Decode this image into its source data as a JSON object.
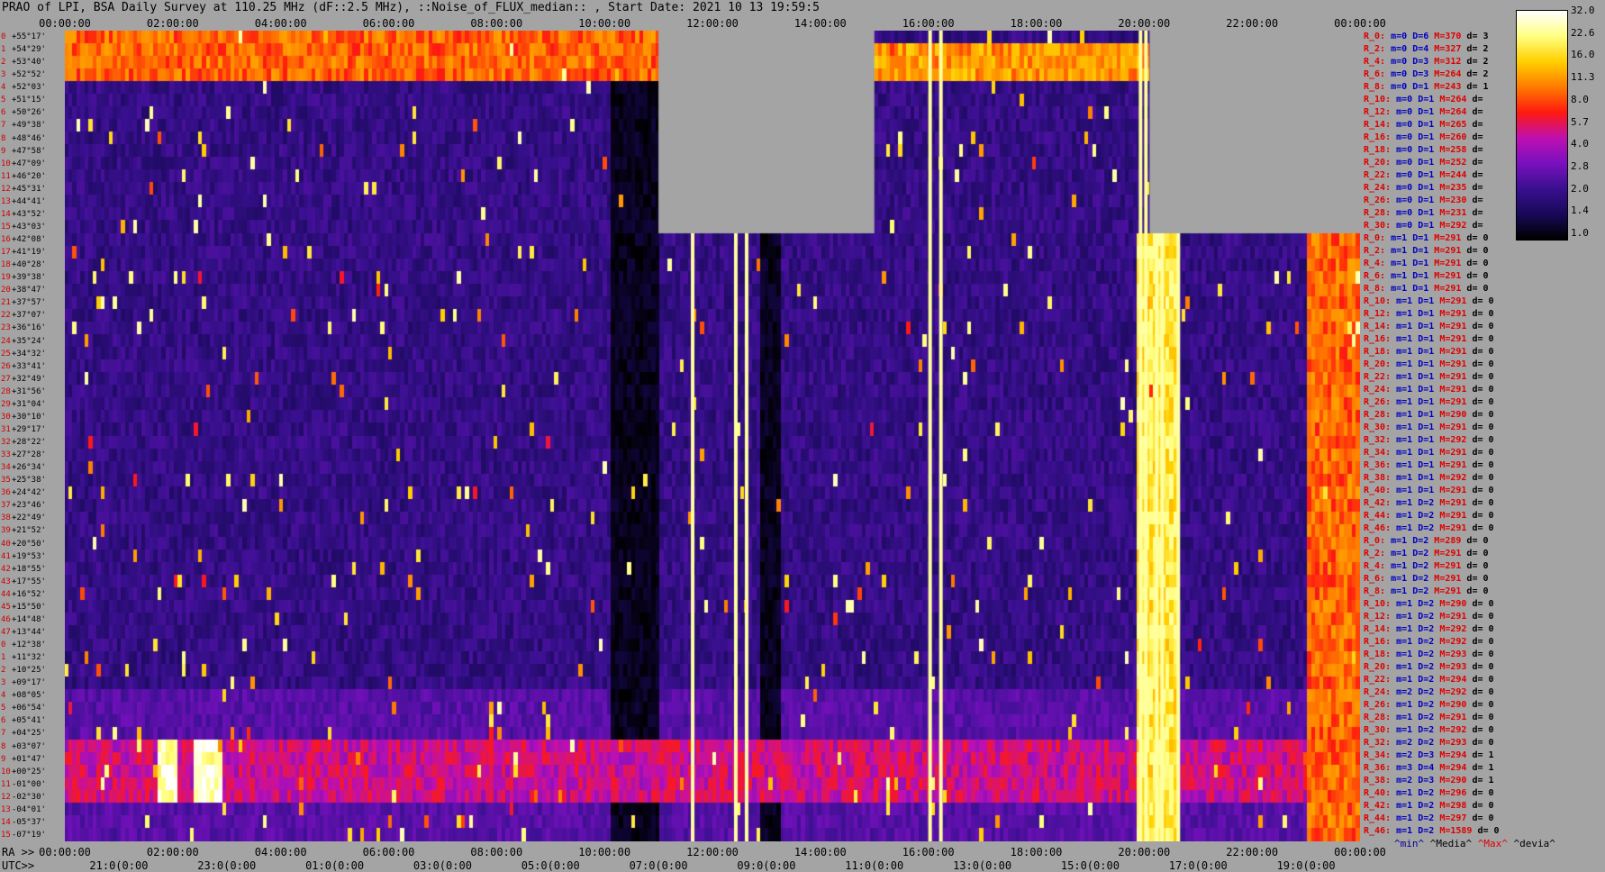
{
  "title": "PRAO of LPI, BSA Daily Survey at 110.25 MHz (dF::2.5 MHz), ::Noise_of_FLUX_median:: , Start Date: 2021 10 13 19:59:5",
  "colors": {
    "background": "#a4a4a4",
    "missing": "#a4a4a4",
    "scale": [
      "#000000",
      "#1a0a5a",
      "#3a1090",
      "#7a10c0",
      "#c010b0",
      "#ff1a10",
      "#ff7a00",
      "#ffd000",
      "#ffff80",
      "#ffffff"
    ]
  },
  "ra_axis": {
    "prefix": "RA >>",
    "ticks": [
      "00:00:00",
      "02:00:00",
      "04:00:00",
      "06:00:00",
      "08:00:00",
      "10:00:00",
      "12:00:00",
      "14:00:00",
      "16:00:00",
      "18:00:00",
      "20:00:00",
      "22:00:00",
      "00:00:00"
    ]
  },
  "utc_axis": {
    "prefix": "UTC>>",
    "ticks": [
      "21:0(0:00",
      "23:0(0:00",
      "01:0(0:00",
      "03:0(0:00",
      "05:0(0:00",
      "07:0(0:00",
      "09:0(0:00",
      "11:0(0:00",
      "13:0(0:00",
      "15:0(0:00",
      "17:0(0:00",
      "19:0(0:00"
    ]
  },
  "dec_labels": [
    "+55°17'",
    "+54°29'",
    "+53°40'",
    "+52°52'",
    "+52°03'",
    "+51°15'",
    "+50°26'",
    "+49°38'",
    "+48°46'",
    "+47°58'",
    "+47°09'",
    "+46°20'",
    "+45°31'",
    "+44°41'",
    "+43°52'",
    "+43°03'",
    "+42°08'",
    "+41°19'",
    "+40°28'",
    "+39°38'",
    "+38°47'",
    "+37°57'",
    "+37°07'",
    "+36°16'",
    "+35°24'",
    "+34°32'",
    "+33°41'",
    "+32°49'",
    "+31°56'",
    "+31°04'",
    "+30°10'",
    "+29°17'",
    "+28°22'",
    "+27°28'",
    "+26°34'",
    "+25°38'",
    "+24°42'",
    "+23°46'",
    "+22°49'",
    "+21°52'",
    "+20°50'",
    "+19°53'",
    "+18°55'",
    "+17°55'",
    "+16°52'",
    "+15°50'",
    "+14°48'",
    "+13°44'",
    "+12°38'",
    "+11°32'",
    "+10°25'",
    "+09°17'",
    "+08°05'",
    "+06°54'",
    "+05°41'",
    "+04°25'",
    "+03°07'",
    "+01°47'",
    "+00°25'",
    "-01°00'",
    "-02°30'",
    "-04°01'",
    "-05°37'",
    "-07°19'"
  ],
  "beams": [
    {
      "name": "R_0:",
      "m": "m=0",
      "d": "D=6",
      "max": "M=370",
      "dev": "d= 3"
    },
    {
      "name": "R_2:",
      "m": "m=0",
      "d": "D=4",
      "max": "M=327",
      "dev": "d= 2"
    },
    {
      "name": "R_4:",
      "m": "m=0",
      "d": "D=3",
      "max": "M=312",
      "dev": "d= 2"
    },
    {
      "name": "R_6:",
      "m": "m=0",
      "d": "D=3",
      "max": "M=264",
      "dev": "d= 2"
    },
    {
      "name": "R_8:",
      "m": "m=0",
      "d": "D=1",
      "max": "M=243",
      "dev": "d= 1"
    },
    {
      "name": "R_10:",
      "m": "m=0",
      "d": "D=1",
      "max": "M=264",
      "dev": "d="
    },
    {
      "name": "R_12:",
      "m": "m=0",
      "d": "D=1",
      "max": "M=264",
      "dev": "d="
    },
    {
      "name": "R_14:",
      "m": "m=0",
      "d": "D=1",
      "max": "M=265",
      "dev": "d="
    },
    {
      "name": "R_16:",
      "m": "m=0",
      "d": "D=1",
      "max": "M=260",
      "dev": "d="
    },
    {
      "name": "R_18:",
      "m": "m=0",
      "d": "D=1",
      "max": "M=258",
      "dev": "d="
    },
    {
      "name": "R_20:",
      "m": "m=0",
      "d": "D=1",
      "max": "M=252",
      "dev": "d="
    },
    {
      "name": "R_22:",
      "m": "m=0",
      "d": "D=1",
      "max": "M=244",
      "dev": "d="
    },
    {
      "name": "R_24:",
      "m": "m=0",
      "d": "D=1",
      "max": "M=235",
      "dev": "d="
    },
    {
      "name": "R_26:",
      "m": "m=0",
      "d": "D=1",
      "max": "M=230",
      "dev": "d="
    },
    {
      "name": "R_28:",
      "m": "m=0",
      "d": "D=1",
      "max": "M=231",
      "dev": "d="
    },
    {
      "name": "R_30:",
      "m": "m=0",
      "d": "D=1",
      "max": "M=292",
      "dev": "d="
    },
    {
      "name": "R_0:",
      "m": "m=1",
      "d": "D=1",
      "max": "M=291",
      "dev": "d= 0"
    },
    {
      "name": "R_2:",
      "m": "m=1",
      "d": "D=1",
      "max": "M=291",
      "dev": "d= 0"
    },
    {
      "name": "R_4:",
      "m": "m=1",
      "d": "D=1",
      "max": "M=291",
      "dev": "d= 0"
    },
    {
      "name": "R_6:",
      "m": "m=1",
      "d": "D=1",
      "max": "M=291",
      "dev": "d= 0"
    },
    {
      "name": "R_8:",
      "m": "m=1",
      "d": "D=1",
      "max": "M=291",
      "dev": "d= 0"
    },
    {
      "name": "R_10:",
      "m": "m=1",
      "d": "D=1",
      "max": "M=291",
      "dev": "d= 0"
    },
    {
      "name": "R_12:",
      "m": "m=1",
      "d": "D=1",
      "max": "M=291",
      "dev": "d= 0"
    },
    {
      "name": "R_14:",
      "m": "m=1",
      "d": "D=1",
      "max": "M=291",
      "dev": "d= 0"
    },
    {
      "name": "R_16:",
      "m": "m=1",
      "d": "D=1",
      "max": "M=291",
      "dev": "d= 0"
    },
    {
      "name": "R_18:",
      "m": "m=1",
      "d": "D=1",
      "max": "M=291",
      "dev": "d= 0"
    },
    {
      "name": "R_20:",
      "m": "m=1",
      "d": "D=1",
      "max": "M=291",
      "dev": "d= 0"
    },
    {
      "name": "R_22:",
      "m": "m=1",
      "d": "D=1",
      "max": "M=291",
      "dev": "d= 0"
    },
    {
      "name": "R_24:",
      "m": "m=1",
      "d": "D=1",
      "max": "M=291",
      "dev": "d= 0"
    },
    {
      "name": "R_26:",
      "m": "m=1",
      "d": "D=1",
      "max": "M=291",
      "dev": "d= 0"
    },
    {
      "name": "R_28:",
      "m": "m=1",
      "d": "D=1",
      "max": "M=290",
      "dev": "d= 0"
    },
    {
      "name": "R_30:",
      "m": "m=1",
      "d": "D=1",
      "max": "M=291",
      "dev": "d= 0"
    },
    {
      "name": "R_32:",
      "m": "m=1",
      "d": "D=1",
      "max": "M=292",
      "dev": "d= 0"
    },
    {
      "name": "R_34:",
      "m": "m=1",
      "d": "D=1",
      "max": "M=291",
      "dev": "d= 0"
    },
    {
      "name": "R_36:",
      "m": "m=1",
      "d": "D=1",
      "max": "M=291",
      "dev": "d= 0"
    },
    {
      "name": "R_38:",
      "m": "m=1",
      "d": "D=1",
      "max": "M=292",
      "dev": "d= 0"
    },
    {
      "name": "R_40:",
      "m": "m=1",
      "d": "D=1",
      "max": "M=291",
      "dev": "d= 0"
    },
    {
      "name": "R_42:",
      "m": "m=1",
      "d": "D=2",
      "max": "M=291",
      "dev": "d= 0"
    },
    {
      "name": "R_44:",
      "m": "m=1",
      "d": "D=2",
      "max": "M=291",
      "dev": "d= 0"
    },
    {
      "name": "R_46:",
      "m": "m=1",
      "d": "D=2",
      "max": "M=291",
      "dev": "d= 0"
    },
    {
      "name": "R_0:",
      "m": "m=1",
      "d": "D=2",
      "max": "M=289",
      "dev": "d= 0"
    },
    {
      "name": "R_2:",
      "m": "m=1",
      "d": "D=2",
      "max": "M=291",
      "dev": "d= 0"
    },
    {
      "name": "R_4:",
      "m": "m=1",
      "d": "D=2",
      "max": "M=291",
      "dev": "d= 0"
    },
    {
      "name": "R_6:",
      "m": "m=1",
      "d": "D=2",
      "max": "M=291",
      "dev": "d= 0"
    },
    {
      "name": "R_8:",
      "m": "m=1",
      "d": "D=2",
      "max": "M=291",
      "dev": "d= 0"
    },
    {
      "name": "R_10:",
      "m": "m=1",
      "d": "D=2",
      "max": "M=290",
      "dev": "d= 0"
    },
    {
      "name": "R_12:",
      "m": "m=1",
      "d": "D=2",
      "max": "M=291",
      "dev": "d= 0"
    },
    {
      "name": "R_14:",
      "m": "m=1",
      "d": "D=2",
      "max": "M=292",
      "dev": "d= 0"
    },
    {
      "name": "R_16:",
      "m": "m=1",
      "d": "D=2",
      "max": "M=292",
      "dev": "d= 0"
    },
    {
      "name": "R_18:",
      "m": "m=1",
      "d": "D=2",
      "max": "M=293",
      "dev": "d= 0"
    },
    {
      "name": "R_20:",
      "m": "m=1",
      "d": "D=2",
      "max": "M=293",
      "dev": "d= 0"
    },
    {
      "name": "R_22:",
      "m": "m=1",
      "d": "D=2",
      "max": "M=294",
      "dev": "d= 0"
    },
    {
      "name": "R_24:",
      "m": "m=2",
      "d": "D=2",
      "max": "M=292",
      "dev": "d= 0"
    },
    {
      "name": "R_26:",
      "m": "m=1",
      "d": "D=2",
      "max": "M=290",
      "dev": "d= 0"
    },
    {
      "name": "R_28:",
      "m": "m=1",
      "d": "D=2",
      "max": "M=291",
      "dev": "d= 0"
    },
    {
      "name": "R_30:",
      "m": "m=1",
      "d": "D=2",
      "max": "M=292",
      "dev": "d= 0"
    },
    {
      "name": "R_32:",
      "m": "m=2",
      "d": "D=2",
      "max": "M=293",
      "dev": "d= 0"
    },
    {
      "name": "R_34:",
      "m": "m=2",
      "d": "D=3",
      "max": "M=294",
      "dev": "d= 1"
    },
    {
      "name": "R_36:",
      "m": "m=3",
      "d": "D=4",
      "max": "M=294",
      "dev": "d= 1"
    },
    {
      "name": "R_38:",
      "m": "m=2",
      "d": "D=3",
      "max": "M=290",
      "dev": "d= 1"
    },
    {
      "name": "R_40:",
      "m": "m=1",
      "d": "D=2",
      "max": "M=296",
      "dev": "d= 0"
    },
    {
      "name": "R_42:",
      "m": "m=1",
      "d": "D=2",
      "max": "M=298",
      "dev": "d= 0"
    },
    {
      "name": "R_44:",
      "m": "m=1",
      "d": "D=2",
      "max": "M=297",
      "dev": "d= 0"
    },
    {
      "name": "R_46:",
      "m": "m=1",
      "d": "D=2",
      "max": "M=1589",
      "dev": "d= 0"
    }
  ],
  "colorbar": {
    "labels": [
      "32.0",
      "22.6",
      "16.0",
      "11.3",
      "8.0",
      "5.7",
      "4.0",
      "2.8",
      "2.0",
      "1.4",
      "1.0"
    ]
  },
  "colorbar_footer": {
    "min": "^min^",
    "med": "^Media^",
    "max": "^Max^",
    "dev": "^devia^"
  },
  "chart_data": {
    "type": "heatmap",
    "title": "PRAO of LPI, BSA Daily Survey at 110.25 MHz (dF::2.5 MHz), ::Noise_of_FLUX_median:: , Start Date: 2021 10 13 19:59:5",
    "xlabel": "RA >>",
    "ylabel": "",
    "x_range_hours": [
      0,
      24
    ],
    "rows": 64,
    "color_scale": "log",
    "color_range": [
      1.0,
      32.0
    ],
    "missing_regions": [
      {
        "ra_hours": [
          11.0,
          15.0
        ],
        "rows": [
          0,
          15
        ]
      },
      {
        "ra_hours": [
          20.1,
          24.0
        ],
        "rows": [
          0,
          15
        ]
      }
    ],
    "bright_columns_ra_hours": [
      11.6,
      12.4,
      12.6,
      16.0,
      16.2,
      19.9,
      20.0,
      20.2,
      20.3,
      20.6
    ],
    "dark_columns_ra_hours": [
      [
        12.9,
        13.3
      ],
      [
        10.1,
        11.0
      ]
    ],
    "hot_regions": [
      {
        "ra_hours": [
          1.7,
          2.1
        ],
        "rows": [
          56,
          60
        ],
        "value": 32
      },
      {
        "ra_hours": [
          2.4,
          2.9
        ],
        "rows": [
          56,
          60
        ],
        "value": 32
      },
      {
        "ra_hours": [
          19.9,
          20.6
        ],
        "rows": [
          16,
          63
        ],
        "value": 22
      },
      {
        "ra_hours": [
          23.0,
          24.0
        ],
        "rows": [
          16,
          63
        ],
        "value": 11
      },
      {
        "ra_hours": [
          0.0,
          11.0
        ],
        "rows": [
          0,
          3
        ],
        "value": 11
      },
      {
        "ra_hours": [
          15.0,
          20.1
        ],
        "rows": [
          1,
          3
        ],
        "value": 14
      },
      {
        "ra_hours": [
          0.0,
          24.0
        ],
        "rows": [
          56,
          60
        ],
        "value": 6
      }
    ]
  }
}
